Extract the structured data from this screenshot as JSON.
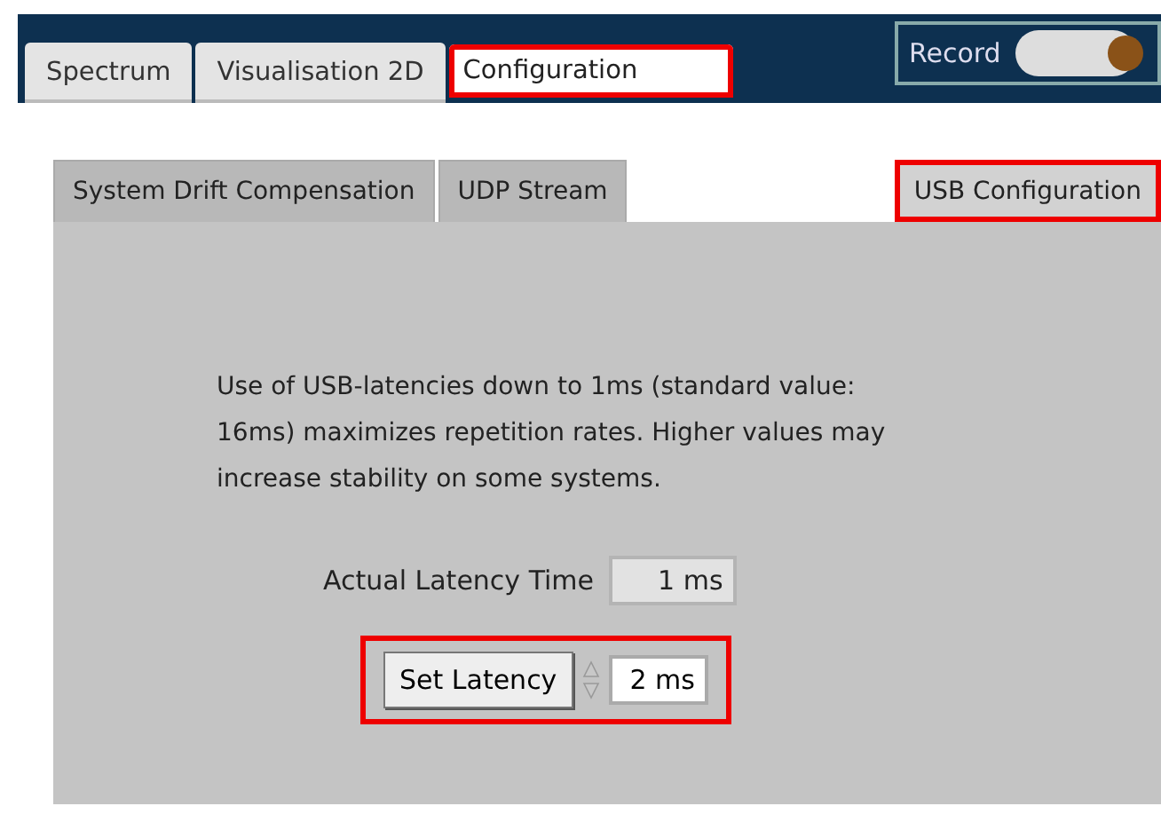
{
  "tabs": [
    {
      "label": "Spectrum",
      "selected": false,
      "highlighted": false
    },
    {
      "label": "Visualisation 2D",
      "selected": false,
      "highlighted": false
    },
    {
      "label": "Configuration",
      "selected": true,
      "highlighted": true
    }
  ],
  "record": {
    "label": "Record",
    "on": true
  },
  "subtabs": [
    {
      "label": "System Drift Compensation",
      "selected": false,
      "highlighted": false
    },
    {
      "label": "UDP Stream",
      "selected": false,
      "highlighted": false
    },
    {
      "label": "USB Configuration",
      "selected": true,
      "highlighted": true
    }
  ],
  "description": "Use of USB-latencies down to 1ms (standard value: 16ms) maximizes repetition rates. Higher values may increase stability on some systems.",
  "actual_latency": {
    "label": "Actual Latency Time",
    "value": "1 ms"
  },
  "set_latency": {
    "button": "Set Latency",
    "value": "2 ms",
    "highlighted": true
  }
}
